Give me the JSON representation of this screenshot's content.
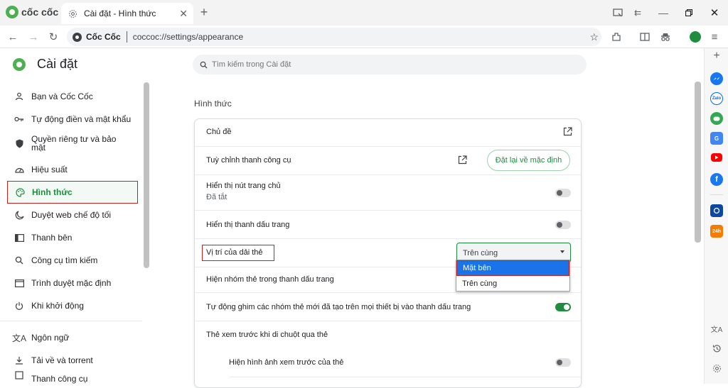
{
  "browser": {
    "brand": "cốc cốc",
    "tab_title": "Cài đặt - Hình thức",
    "site_chip": "Cốc Cốc",
    "url": "coccoc://settings/appearance"
  },
  "sidebar": {
    "title": "Cài đặt",
    "items": [
      {
        "label": "Bạn và Cốc Cốc",
        "icon": "person-icon"
      },
      {
        "label": "Tự động điền và mật khẩu",
        "icon": "key-icon"
      },
      {
        "label": "Quyền riêng tư và bảo mật",
        "icon": "shield-icon"
      },
      {
        "label": "Hiệu suất",
        "icon": "speedometer-icon"
      },
      {
        "label": "Hình thức",
        "icon": "palette-icon"
      },
      {
        "label": "Duyệt web chế độ tối",
        "icon": "moon-icon"
      },
      {
        "label": "Thanh bên",
        "icon": "sidebar-icon"
      },
      {
        "label": "Công cụ tìm kiếm",
        "icon": "search-icon"
      },
      {
        "label": "Trình duyệt mặc định",
        "icon": "browser-icon"
      },
      {
        "label": "Khi khởi động",
        "icon": "power-icon"
      },
      {
        "label": "Ngôn ngữ",
        "icon": "translate-icon"
      },
      {
        "label": "Tải về và torrent",
        "icon": "download-icon"
      },
      {
        "label": "Thanh công cụ",
        "icon": "toolbar-icon"
      }
    ]
  },
  "search": {
    "placeholder": "Tìm kiếm trong Cài đặt"
  },
  "section": {
    "title": "Hình thức",
    "rows": {
      "theme": "Chủ đề",
      "customize_toolbar": "Tuỳ chỉnh thanh công cụ",
      "reset_button": "Đặt lại về mặc định",
      "home_button": "Hiển thị nút trang chủ",
      "home_button_sub": "Đã tắt",
      "bookmarks_bar": "Hiển thị thanh dấu trang",
      "tab_position": "Vị trí của dải thẻ",
      "tab_position_value": "Trên cùng",
      "tab_groups_in_bookmarks": "Hiện nhóm thẻ trong thanh dấu trang",
      "auto_pin_groups": "Tự động ghim các nhóm thẻ mới đã tạo trên mọi thiết bị vào thanh dấu trang",
      "hover_preview": "Thẻ xem trước khi di chuột qua thẻ",
      "hover_preview_image": "Hiện hình ảnh xem trước của thẻ"
    },
    "toggles": {
      "home_button": false,
      "bookmarks_bar": false,
      "auto_pin_groups": true,
      "hover_preview_image": false
    },
    "dropdown_options": [
      "Mặt bên",
      "Trên cùng"
    ]
  },
  "colors": {
    "accent": "#1e8e3e",
    "highlight": "#c5221f",
    "selected": "#1a73e8"
  }
}
